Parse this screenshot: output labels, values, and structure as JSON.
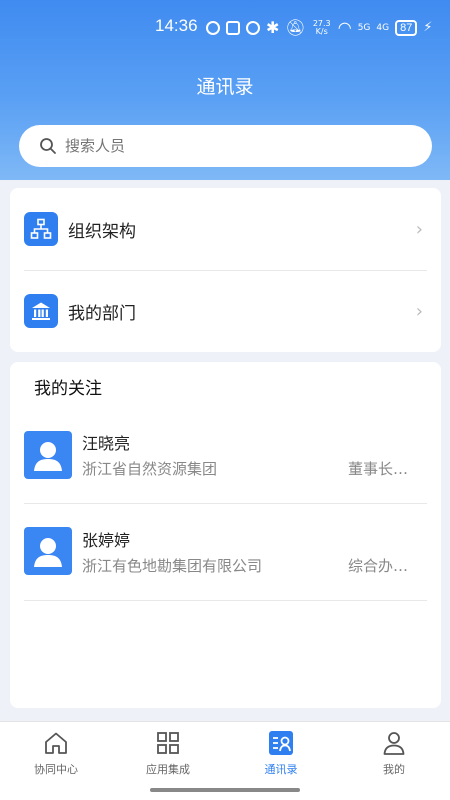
{
  "status_bar": {
    "time": "14:36",
    "net_speed": "27.3 K/s",
    "signal_1": "5G",
    "signal_2": "4G",
    "battery": "87"
  },
  "header": {
    "title": "通讯录"
  },
  "search": {
    "placeholder": "搜索人员"
  },
  "nav": [
    {
      "label": "组织架构",
      "icon": "org-chart-icon"
    },
    {
      "label": "我的部门",
      "icon": "building-icon"
    }
  ],
  "favorites": {
    "title": "我的关注",
    "contacts": [
      {
        "name": "汪晓亮",
        "org": "浙江省自然资源集团",
        "position": "董事长…"
      },
      {
        "name": "张婷婷",
        "org": "浙江有色地勘集团有限公司",
        "position": "综合办…"
      }
    ]
  },
  "tabs": [
    {
      "label": "协同中心",
      "icon": "home-icon",
      "active": false
    },
    {
      "label": "应用集成",
      "icon": "grid-icon",
      "active": false
    },
    {
      "label": "通讯录",
      "icon": "contacts-icon",
      "active": true
    },
    {
      "label": "我的",
      "icon": "user-icon",
      "active": false
    }
  ],
  "colors": {
    "accent": "#2f7ff0",
    "header_top": "#3f8bf0",
    "header_bottom": "#7fb8f6"
  }
}
